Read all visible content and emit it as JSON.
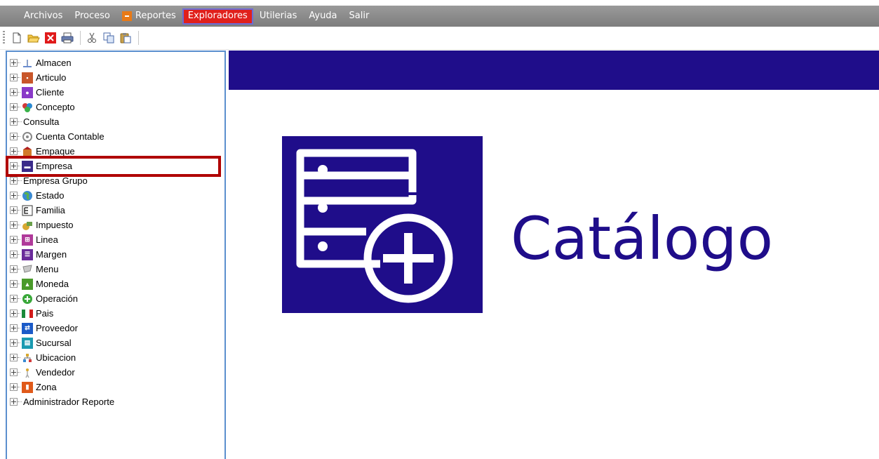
{
  "menu": {
    "items": [
      "Archivos",
      "Proceso",
      "Reportes",
      "Exploradores",
      "Utilerias",
      "Ayuda",
      "Salir"
    ],
    "active": "Exploradores",
    "active_color": "#e0201c"
  },
  "toolbar": {
    "buttons": [
      "new-icon",
      "open-folder-icon",
      "delete-icon",
      "print-icon",
      "cut-icon",
      "copy-icon",
      "paste-icon"
    ]
  },
  "tree": {
    "items": [
      {
        "label": "Almacen",
        "icon": "warehouse-icon"
      },
      {
        "label": "Articulo",
        "icon": "article-icon"
      },
      {
        "label": "Cliente",
        "icon": "client-icon"
      },
      {
        "label": "Concepto",
        "icon": "concept-icon"
      },
      {
        "label": "Consulta",
        "icon": ""
      },
      {
        "label": "Cuenta Contable",
        "icon": "account-icon"
      },
      {
        "label": "Empaque",
        "icon": "package-icon"
      },
      {
        "label": "Empresa",
        "icon": "company-icon"
      },
      {
        "label": "Empresa Grupo",
        "icon": ""
      },
      {
        "label": "Estado",
        "icon": "state-globe-icon"
      },
      {
        "label": "Familia",
        "icon": "family-icon"
      },
      {
        "label": "Impuesto",
        "icon": "tax-icon"
      },
      {
        "label": "Linea",
        "icon": "line-icon"
      },
      {
        "label": "Margen",
        "icon": "margin-icon"
      },
      {
        "label": "Menu",
        "icon": "menu-icon"
      },
      {
        "label": "Moneda",
        "icon": "currency-icon"
      },
      {
        "label": "Operación",
        "icon": "operation-icon"
      },
      {
        "label": "Pais",
        "icon": "country-flag-icon"
      },
      {
        "label": "Proveedor",
        "icon": "supplier-icon"
      },
      {
        "label": "Sucursal",
        "icon": "branch-icon"
      },
      {
        "label": "Ubicacion",
        "icon": "location-icon"
      },
      {
        "label": "Vendedor",
        "icon": "seller-icon"
      },
      {
        "label": "Zona",
        "icon": "zone-icon"
      },
      {
        "label": "Administrador Reporte",
        "icon": ""
      }
    ],
    "highlighted": "Empresa",
    "highlight_color": "#b00000"
  },
  "content": {
    "title": "Catálogo",
    "accent_color": "#1f0d8a",
    "logo_icon": "catalog-add-icon"
  }
}
